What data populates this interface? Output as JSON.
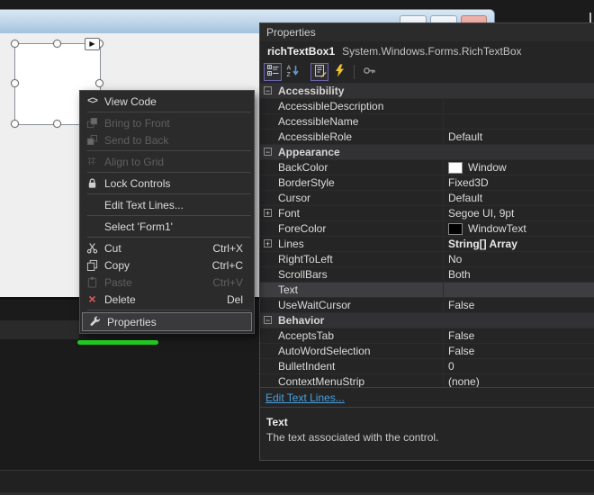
{
  "designer": {
    "titlebar_buttons": [
      {
        "name": "minimize"
      },
      {
        "name": "maximize"
      },
      {
        "name": "close"
      }
    ],
    "smart_tag_glyph": "▶"
  },
  "context_menu": {
    "items": [
      {
        "type": "item",
        "label": "View Code",
        "icon": "view-code",
        "enabled": true
      },
      {
        "type": "separator"
      },
      {
        "type": "item",
        "label": "Bring to Front",
        "icon": "bring-to-front",
        "enabled": false
      },
      {
        "type": "item",
        "label": "Send to Back",
        "icon": "send-to-back",
        "enabled": false
      },
      {
        "type": "separator"
      },
      {
        "type": "item",
        "label": "Align to Grid",
        "icon": "align-to-grid",
        "enabled": false
      },
      {
        "type": "separator"
      },
      {
        "type": "item",
        "label": "Lock Controls",
        "icon": "lock",
        "enabled": true
      },
      {
        "type": "separator"
      },
      {
        "type": "item",
        "label": "Edit Text Lines...",
        "icon": null,
        "enabled": true
      },
      {
        "type": "separator"
      },
      {
        "type": "item",
        "label": "Select 'Form1'",
        "icon": null,
        "enabled": true
      },
      {
        "type": "separator"
      },
      {
        "type": "item",
        "label": "Cut",
        "icon": "cut",
        "shortcut": "Ctrl+X",
        "enabled": true
      },
      {
        "type": "item",
        "label": "Copy",
        "icon": "copy",
        "shortcut": "Ctrl+C",
        "enabled": true
      },
      {
        "type": "item",
        "label": "Paste",
        "icon": "paste",
        "shortcut": "Ctrl+V",
        "enabled": false
      },
      {
        "type": "item",
        "label": "Delete",
        "icon": "delete",
        "shortcut": "Del",
        "enabled": true
      },
      {
        "type": "separator"
      },
      {
        "type": "item",
        "label": "Properties",
        "icon": "wrench",
        "enabled": true,
        "selected": true
      }
    ]
  },
  "properties_panel": {
    "title": "Properties",
    "object_name": "richTextBox1",
    "object_type": "System.Windows.Forms.RichTextBox",
    "toolbar": [
      {
        "name": "categorized",
        "selected": true
      },
      {
        "name": "alphabetical",
        "selected": false
      },
      {
        "name": "gap"
      },
      {
        "name": "properties",
        "selected": true
      },
      {
        "name": "events",
        "selected": false
      },
      {
        "name": "separator"
      },
      {
        "name": "property-pages",
        "selected": false
      }
    ],
    "grid_rows": [
      {
        "kind": "category",
        "name": "Accessibility",
        "toggle": "−"
      },
      {
        "kind": "property",
        "name": "AccessibleDescription",
        "value": ""
      },
      {
        "kind": "property",
        "name": "AccessibleName",
        "value": ""
      },
      {
        "kind": "property",
        "name": "AccessibleRole",
        "value": "Default"
      },
      {
        "kind": "category",
        "name": "Appearance",
        "toggle": "−"
      },
      {
        "kind": "property",
        "name": "BackColor",
        "value": "Window",
        "swatch": "#ffffff"
      },
      {
        "kind": "property",
        "name": "BorderStyle",
        "value": "Fixed3D"
      },
      {
        "kind": "property",
        "name": "Cursor",
        "value": "Default"
      },
      {
        "kind": "property",
        "name": "Font",
        "value": "Segoe UI, 9pt",
        "toggle": "+"
      },
      {
        "kind": "property",
        "name": "ForeColor",
        "value": "WindowText",
        "swatch": "#000000"
      },
      {
        "kind": "property",
        "name": "Lines",
        "value": "String[] Array",
        "toggle": "+",
        "bold_value": true
      },
      {
        "kind": "property",
        "name": "RightToLeft",
        "value": "No"
      },
      {
        "kind": "property",
        "name": "ScrollBars",
        "value": "Both"
      },
      {
        "kind": "property",
        "name": "Text",
        "value": "",
        "selected": true
      },
      {
        "kind": "property",
        "name": "UseWaitCursor",
        "value": "False"
      },
      {
        "kind": "category",
        "name": "Behavior",
        "toggle": "−"
      },
      {
        "kind": "property",
        "name": "AcceptsTab",
        "value": "False"
      },
      {
        "kind": "property",
        "name": "AutoWordSelection",
        "value": "False"
      },
      {
        "kind": "property",
        "name": "BulletIndent",
        "value": "0"
      },
      {
        "kind": "property",
        "name": "ContextMenuStrip",
        "value": "(none)"
      }
    ],
    "verb_link": "Edit Text Lines...",
    "description": {
      "title": "Text",
      "text": "The text associated with the control."
    }
  },
  "colors": {
    "annotation_green": "#1fc71f",
    "selected_toolbar_border": "#6a67b1",
    "link_blue": "#4aa0dc",
    "form_titlebar_blue": "#a2c2de"
  }
}
